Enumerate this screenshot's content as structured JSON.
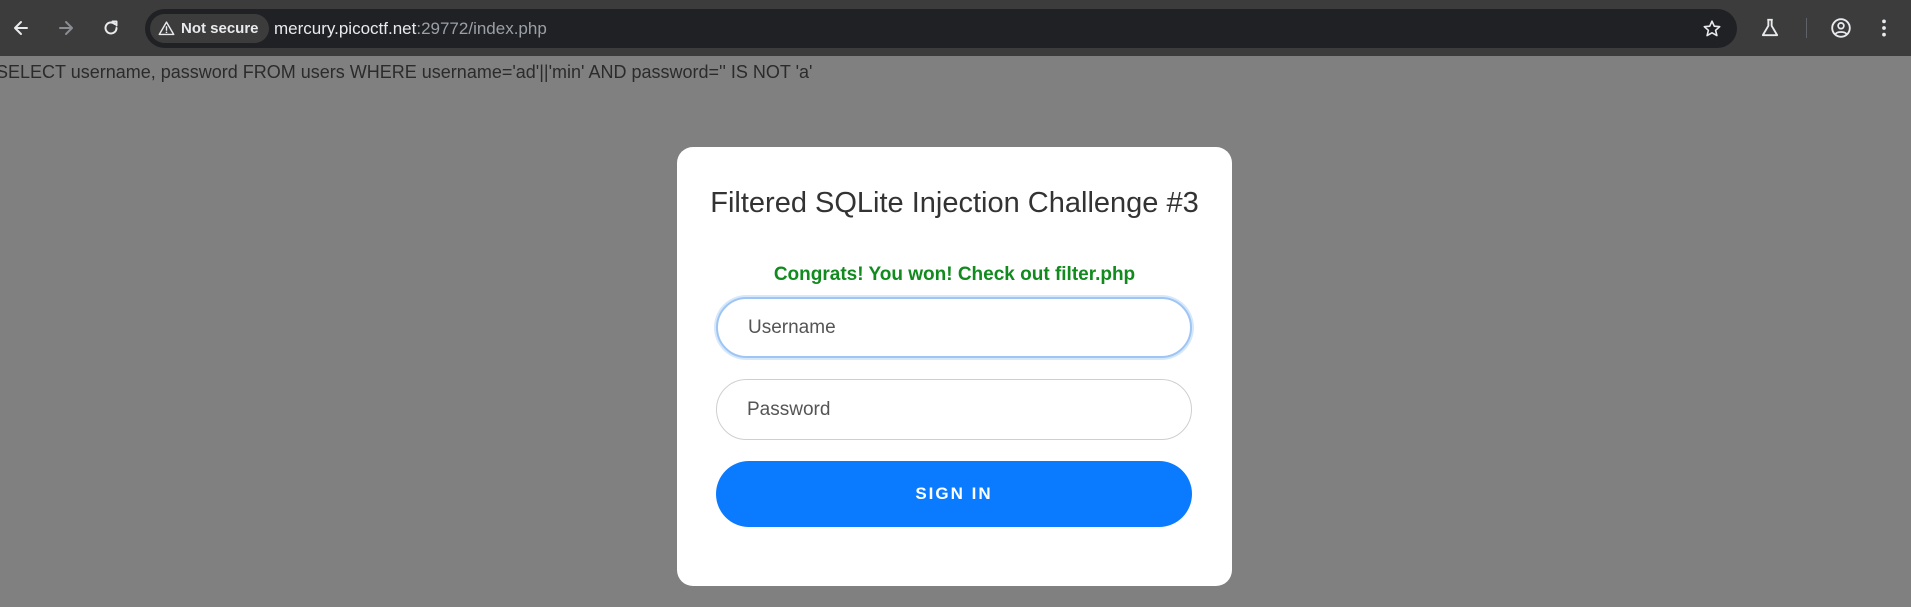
{
  "browser": {
    "security_label": "Not secure",
    "url_host": "mercury.picoctf.net",
    "url_rest": ":29772/index.php",
    "icons": {
      "back": "back-arrow-icon",
      "forward": "forward-arrow-icon",
      "reload": "reload-icon",
      "security": "warning-triangle-icon",
      "bookmark": "star-icon",
      "labs": "flask-icon",
      "profile": "profile-icon",
      "menu": "kebab-menu-icon"
    }
  },
  "page": {
    "debug_query": "SELECT username, password FROM users WHERE username='ad'||'min' AND password='' IS NOT 'a'",
    "background_color": "#808080"
  },
  "login_card": {
    "title": "Filtered SQLite Injection Challenge #3",
    "success_message": "Congrats! You won! Check out filter.php",
    "success_color": "#118a1e",
    "username_placeholder": "Username",
    "username_value": "",
    "password_placeholder": "Password",
    "password_value": "",
    "sign_in_label": "SIGN IN",
    "accent_color": "#0a7bff"
  }
}
